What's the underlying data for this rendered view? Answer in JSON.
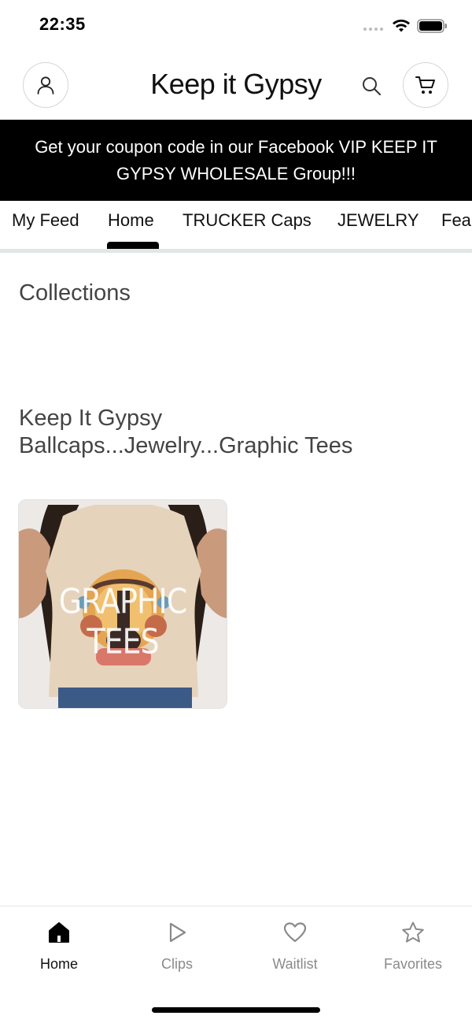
{
  "status_bar": {
    "time": "22:35"
  },
  "header": {
    "title": "Keep it Gypsy"
  },
  "promo_banner": {
    "text": "Get your coupon code in our Facebook VIP KEEP IT GYPSY WHOLESALE Group!!!"
  },
  "tabs": [
    {
      "label": "My Feed",
      "active": false
    },
    {
      "label": "Home",
      "active": true
    },
    {
      "label": "TRUCKER Caps",
      "active": false
    },
    {
      "label": "JEWELRY",
      "active": false
    },
    {
      "label": "Fea",
      "active": false
    }
  ],
  "main": {
    "section_title": "Collections",
    "collection_heading_line1": "Keep It Gypsy",
    "collection_heading_line2": "Ballcaps...Jewelry...Graphic Tees",
    "card": {
      "overlay_text": "GRAPHIC TEES"
    }
  },
  "bottom_nav": [
    {
      "label": "Home",
      "icon": "home-icon",
      "active": true
    },
    {
      "label": "Clips",
      "icon": "play-icon",
      "active": false
    },
    {
      "label": "Waitlist",
      "icon": "heart-icon",
      "active": false
    },
    {
      "label": "Favorites",
      "icon": "star-icon",
      "active": false
    }
  ],
  "colors": {
    "banner_bg": "#000000",
    "inactive_nav": "#8a8a8a",
    "text_muted": "#444444"
  }
}
